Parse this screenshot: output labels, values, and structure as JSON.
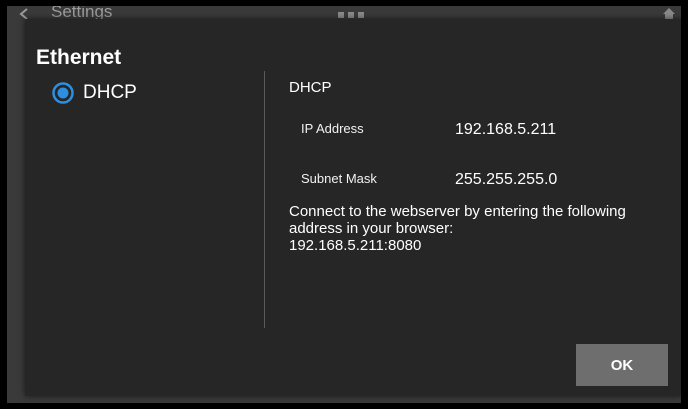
{
  "app_bar": {
    "title": "Settings",
    "icons": {
      "back": "chevron-left-icon",
      "menu": "dots-icon",
      "home": "home-icon"
    }
  },
  "dialog": {
    "title": "Ethernet",
    "radio_options": [
      {
        "label": "DHCP",
        "selected": true
      }
    ],
    "detail": {
      "heading": "DHCP",
      "fields": [
        {
          "label": "IP Address",
          "value": "192.168.5.211"
        },
        {
          "label": "Subnet Mask",
          "value": "255.255.255.0"
        }
      ],
      "connect_lines": [
        "Connect to the webserver by entering the following",
        "address in your browser:",
        "192.168.5.211:8080"
      ]
    },
    "ok_label": "OK"
  },
  "colors": {
    "accent": "#2d8fe0",
    "dialog_bg": "#262626",
    "button_bg": "#6e6e6e"
  }
}
